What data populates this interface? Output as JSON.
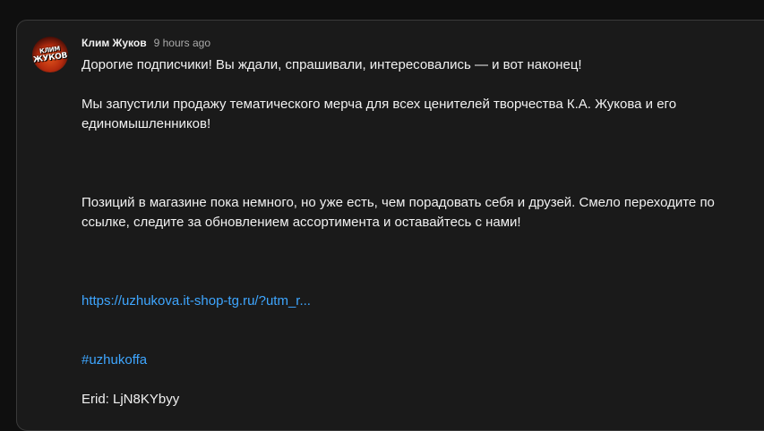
{
  "post": {
    "author": "Клим Жуков",
    "timestamp": "9 hours ago",
    "avatar_text": [
      "КЛИМ",
      "ЖУКОВ"
    ],
    "paragraphs": [
      "Дорогие подписчики! Вы ждали, спрашивали, интересовались — и вот наконец!",
      "Мы запустили продажу тематического мерча для всех ценителей творчества К.А. Жукова и его единомышленников!",
      "Позиций в магазине пока немного, но уже есть, чем порадовать себя и друзей. Смело переходите по ссылке, следите за обновлением ассортимента и оставайтесь с нами!"
    ],
    "link_text": "https://uzhukova.it-shop-tg.ru/?utm_r...",
    "hashtag": "#uzhukoffa",
    "erid": "Erid: LjN8KYbyy"
  },
  "colors": {
    "background": "#0f0f0f",
    "card": "#1a1a1a",
    "text": "#f1f1f1",
    "secondary_text": "#aaaaaa",
    "link": "#3ea6ff"
  }
}
